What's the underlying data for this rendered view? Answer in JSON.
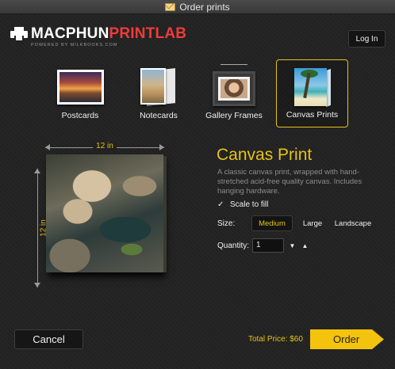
{
  "window": {
    "title": "Order prints"
  },
  "logo": {
    "brand_white": "MACPHUN",
    "brand_red": "PRINTLAB",
    "tagline": "POWERED BY MILKBOOKS.COM"
  },
  "header": {
    "login_label": "Log In"
  },
  "products": [
    {
      "label": "Postcards",
      "selected": false
    },
    {
      "label": "Notecards",
      "selected": false
    },
    {
      "label": "Gallery Frames",
      "selected": false
    },
    {
      "label": "Canvas Prints",
      "selected": true
    }
  ],
  "preview": {
    "width_label": "12 in",
    "height_label": "12 in"
  },
  "details": {
    "title": "Canvas Print",
    "description": "A classic canvas print, wrapped with hand-stretched acid-free quality canvas. Includes hanging hardware.",
    "scale_to_fill_label": "Scale to fill",
    "scale_to_fill_checked": true,
    "size_label": "Size:",
    "size_options": [
      "Medium",
      "Large",
      "Landscape"
    ],
    "size_selected": "Medium",
    "quantity_label": "Quantity:",
    "quantity_value": "1"
  },
  "footer": {
    "cancel_label": "Cancel",
    "total_price": "Total Price: $60",
    "order_label": "Order"
  },
  "colors": {
    "accent": "#e6c21a",
    "order_button": "#f4c30d",
    "brand_red": "#ef3b3b",
    "background": "#222222"
  }
}
